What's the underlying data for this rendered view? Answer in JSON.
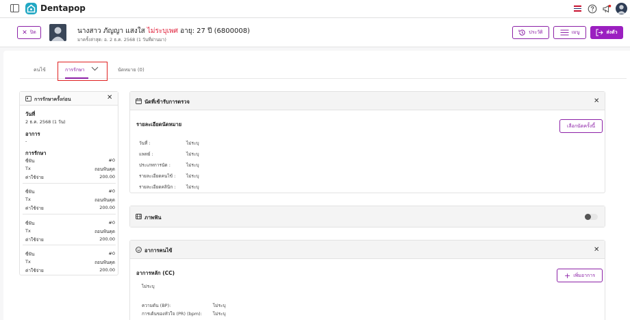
{
  "app": {
    "name": "Dentapop"
  },
  "patient": {
    "close_label": "ปิด",
    "name_prefix": "นางสาว ภัญญา แสงใส",
    "gender": "ไม่ระบุเพศ",
    "age_id": "อายุ: 27 ปี (6800008)",
    "last_visit": "มาครั้งล่าสุด: อ. 2 ธ.ค. 2568 (1 วันที่ผ่านมา)",
    "history_label": "ประวัติ",
    "menu_label": "เมนู",
    "send_label": "ส่งตัว"
  },
  "tabs": [
    {
      "label": "คนไข้"
    },
    {
      "label": "การรักษา"
    },
    {
      "label": "นัดหมาย (0)"
    }
  ],
  "previous_treatment": {
    "title": "การรักษาครั้งก่อน",
    "date_heading": "วันที่",
    "date_value": "2 ธ.ค. 2568 (1 วัน)",
    "symptom_heading": "อาการ",
    "symptom_value": "-",
    "treatment_heading": "การรักษา",
    "tooth_label": "ซี่ฟัน",
    "tx_label": "Tx",
    "cost_label": "ค่าใช้จ่าย",
    "items": [
      {
        "tooth": "#0",
        "tx": "ถอนฟันคุด",
        "cost": "200.00"
      },
      {
        "tooth": "#0",
        "tx": "ถอนฟันคุด",
        "cost": "200.00"
      },
      {
        "tooth": "#0",
        "tx": "ถอนฟันคุด",
        "cost": "200.00"
      },
      {
        "tooth": "#0",
        "tx": "ถอนฟันคุด",
        "cost": "200.00"
      }
    ]
  },
  "appointment_card": {
    "title": "นัดที่เข้ารับการตรวจ",
    "subtitle": "รายละเอียดนัดหมาย",
    "select_button": "เลือกนัดครั้งนี้",
    "rows": [
      {
        "label": "วันที่ :",
        "value": "ไม่ระบุ"
      },
      {
        "label": "แพทย์ :",
        "value": "ไม่ระบุ"
      },
      {
        "label": "ประเภทการนัด :",
        "value": "ไม่ระบุ"
      },
      {
        "label": "รายละเอียดคนไข้ :",
        "value": "ไม่ระบุ"
      },
      {
        "label": "รายละเอียดคลินิก :",
        "value": "ไม่ระบุ"
      }
    ]
  },
  "xray_card": {
    "title": "ภาพฟัน",
    "toggle_on": false
  },
  "symptom_card": {
    "title": "อาการคนไข้",
    "cc_heading": "อาการหลัก (CC)",
    "cc_value": "ไม่ระบุ",
    "add_button": "เพิ่มอาการ",
    "vitals": [
      {
        "label": "ความดัน (BP):",
        "value": "ไม่ระบุ"
      },
      {
        "label": "การเต้นของหัวใจ (PR) (bpm):",
        "value": "ไม่ระบุ"
      }
    ]
  },
  "colors": {
    "accent": "#9b1fc0",
    "gender": "#e0213b",
    "logo": "#22a8c4"
  }
}
